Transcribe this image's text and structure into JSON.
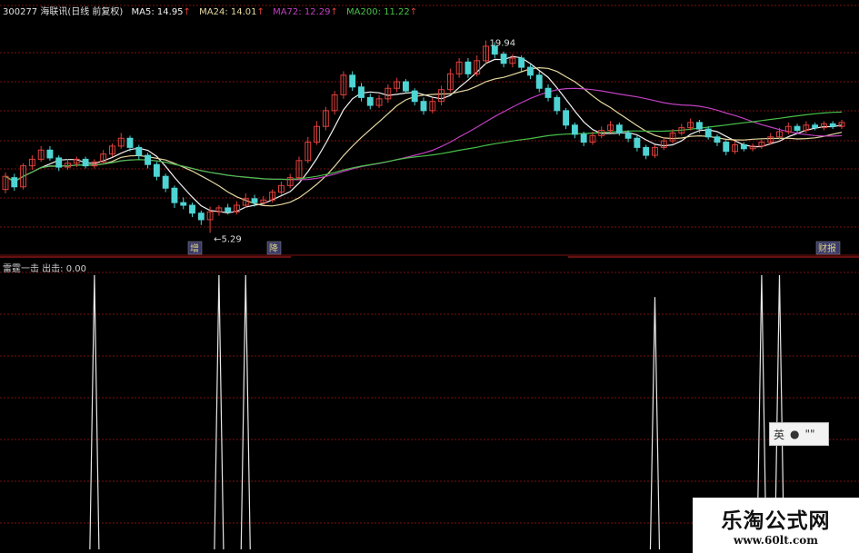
{
  "header": {
    "code_title": "300277 海联讯(日线 前复权)",
    "ma5": "MA5: 14.95",
    "ma24": "MA24: 14.01",
    "ma72": "MA72: 12.29",
    "ma200": "MA200: 11.22",
    "arrows": [
      "↑",
      "↑",
      "↑",
      "↑"
    ]
  },
  "colors": {
    "up": "#e0413c",
    "down": "#4fd4d4",
    "ma5": "#f2f2f2",
    "ma24": "#e6d8a0",
    "ma72": "#c040c0",
    "ma200": "#48c048",
    "grid": "#7a1010",
    "signal": "#e8e8e8",
    "header_code": "#e0e0e0",
    "header_ma24": "#e6d8a0",
    "header_ma72": "#c040c0",
    "header_ma200": "#48c048"
  },
  "annotations": {
    "high_label": "19.94",
    "low_label": "←5.29",
    "markers": [
      "增",
      "降",
      "财报"
    ]
  },
  "indicator": {
    "title": "雷霆一击 出击: 0.00"
  },
  "ime_toolbar": {
    "lang": "英",
    "icon2": "●",
    "icon3": "\"\""
  },
  "watermark": {
    "line1": "乐淘公式网",
    "line2": "www.60lt.com"
  },
  "chart_data": [
    {
      "type": "candlestick",
      "title": "300277 海联讯(日线 前复权)",
      "ylim": [
        4.5,
        21.5
      ],
      "candles": [
        [
          8.6,
          9.6,
          9.9,
          8.3
        ],
        [
          9.5,
          8.8,
          9.8,
          8.5
        ],
        [
          8.8,
          10.4,
          10.6,
          8.6
        ],
        [
          10.4,
          10.9,
          11.2,
          10.1
        ],
        [
          10.9,
          11.6,
          11.9,
          10.7
        ],
        [
          11.6,
          11.0,
          11.9,
          10.8
        ],
        [
          11.0,
          10.3,
          11.2,
          10.0
        ],
        [
          10.3,
          10.6,
          10.9,
          10.1
        ],
        [
          10.6,
          10.9,
          11.1,
          10.3
        ],
        [
          10.9,
          10.4,
          11.1,
          10.2
        ],
        [
          10.4,
          10.7,
          10.9,
          10.2
        ],
        [
          10.7,
          11.3,
          11.6,
          10.5
        ],
        [
          11.3,
          11.9,
          12.1,
          11.1
        ],
        [
          11.9,
          12.5,
          12.9,
          11.7
        ],
        [
          12.5,
          11.8,
          12.7,
          11.5
        ],
        [
          11.8,
          11.2,
          12.0,
          10.9
        ],
        [
          11.2,
          10.5,
          11.4,
          10.2
        ],
        [
          10.5,
          9.6,
          10.7,
          9.3
        ],
        [
          9.6,
          8.7,
          9.8,
          8.4
        ],
        [
          8.7,
          7.6,
          8.9,
          7.2
        ],
        [
          7.6,
          7.4,
          8.0,
          7.1
        ],
        [
          7.4,
          6.8,
          7.6,
          6.5
        ],
        [
          6.8,
          6.3,
          7.0,
          5.9
        ],
        [
          6.3,
          6.9,
          7.3,
          5.3
        ],
        [
          6.9,
          7.2,
          7.4,
          6.6
        ],
        [
          7.2,
          6.9,
          7.5,
          6.7
        ],
        [
          6.9,
          7.4,
          7.7,
          6.7
        ],
        [
          7.4,
          7.9,
          8.3,
          7.2
        ],
        [
          7.9,
          7.6,
          8.2,
          7.3
        ],
        [
          7.6,
          7.8,
          8.1,
          7.4
        ],
        [
          7.8,
          8.4,
          8.6,
          7.6
        ],
        [
          8.4,
          8.9,
          9.2,
          8.2
        ],
        [
          8.9,
          9.5,
          9.8,
          8.7
        ],
        [
          9.5,
          10.8,
          11.1,
          9.3
        ],
        [
          10.8,
          12.2,
          12.6,
          10.6
        ],
        [
          12.2,
          13.4,
          13.8,
          12.0
        ],
        [
          13.4,
          14.6,
          14.9,
          13.1
        ],
        [
          14.6,
          15.8,
          16.1,
          14.3
        ],
        [
          15.8,
          17.3,
          17.6,
          15.5
        ],
        [
          17.3,
          16.4,
          17.6,
          16.1
        ],
        [
          16.4,
          15.6,
          16.7,
          15.3
        ],
        [
          15.6,
          15.0,
          15.9,
          14.7
        ],
        [
          15.0,
          15.5,
          15.8,
          14.8
        ],
        [
          15.5,
          16.3,
          16.6,
          15.2
        ],
        [
          16.3,
          16.8,
          17.1,
          16.0
        ],
        [
          16.8,
          16.1,
          17.0,
          15.9
        ],
        [
          16.1,
          15.3,
          16.3,
          15.0
        ],
        [
          15.3,
          14.6,
          15.6,
          14.3
        ],
        [
          14.6,
          15.3,
          15.6,
          14.4
        ],
        [
          15.3,
          16.2,
          16.5,
          15.0
        ],
        [
          16.2,
          17.4,
          17.8,
          16.0
        ],
        [
          17.4,
          18.3,
          18.6,
          17.1
        ],
        [
          18.3,
          17.4,
          18.6,
          17.1
        ],
        [
          17.4,
          18.4,
          18.8,
          17.2
        ],
        [
          18.4,
          19.5,
          19.94,
          18.1
        ],
        [
          19.5,
          18.9,
          19.8,
          18.6
        ],
        [
          18.9,
          18.2,
          19.1,
          17.9
        ],
        [
          18.2,
          18.6,
          18.9,
          17.9
        ],
        [
          18.6,
          17.9,
          18.8,
          17.6
        ],
        [
          17.9,
          17.3,
          18.1,
          17.0
        ],
        [
          17.3,
          16.3,
          17.6,
          16.0
        ],
        [
          16.3,
          15.6,
          16.6,
          15.3
        ],
        [
          15.6,
          14.6,
          15.8,
          14.3
        ],
        [
          14.6,
          13.5,
          14.8,
          13.2
        ],
        [
          13.5,
          12.8,
          13.7,
          12.5
        ],
        [
          12.8,
          12.2,
          13.0,
          11.9
        ],
        [
          12.2,
          12.7,
          13.0,
          12.0
        ],
        [
          12.7,
          13.1,
          13.4,
          12.5
        ],
        [
          13.1,
          13.5,
          13.8,
          12.9
        ],
        [
          13.5,
          12.9,
          13.7,
          12.7
        ],
        [
          12.9,
          12.5,
          13.1,
          12.2
        ],
        [
          12.5,
          11.8,
          12.7,
          11.5
        ],
        [
          11.8,
          11.2,
          12.0,
          10.9
        ],
        [
          11.2,
          11.8,
          12.0,
          11.0
        ],
        [
          11.8,
          12.3,
          12.6,
          11.6
        ],
        [
          12.3,
          12.9,
          13.2,
          12.1
        ],
        [
          12.9,
          13.3,
          13.6,
          12.7
        ],
        [
          13.3,
          13.7,
          14.0,
          13.1
        ],
        [
          13.7,
          13.2,
          13.9,
          12.9
        ],
        [
          13.2,
          12.6,
          13.4,
          12.4
        ],
        [
          12.6,
          12.2,
          12.8,
          11.9
        ],
        [
          12.2,
          11.5,
          12.4,
          11.2
        ],
        [
          11.5,
          12.0,
          12.3,
          11.3
        ],
        [
          12.0,
          11.7,
          12.2,
          11.5
        ],
        [
          11.7,
          11.9,
          12.1,
          11.5
        ],
        [
          11.9,
          12.2,
          12.4,
          11.7
        ],
        [
          12.2,
          12.6,
          12.9,
          12.0
        ],
        [
          12.6,
          13.0,
          13.3,
          12.4
        ],
        [
          13.0,
          13.4,
          13.7,
          12.8
        ],
        [
          13.4,
          13.1,
          13.6,
          12.9
        ],
        [
          13.1,
          13.5,
          13.8,
          12.9
        ],
        [
          13.5,
          13.3,
          13.7,
          13.1
        ],
        [
          13.3,
          13.6,
          13.8,
          13.1
        ],
        [
          13.6,
          13.4,
          13.8,
          13.2
        ],
        [
          13.4,
          13.7,
          13.9,
          13.2
        ]
      ],
      "annotations": [
        {
          "text": "19.94",
          "x": 54,
          "y": 19.94
        },
        {
          "text": "←5.29",
          "x": 23,
          "y": 5.29
        }
      ]
    },
    {
      "type": "line",
      "title": "雷霆一击 出击: 0.00",
      "series": [
        {
          "name": "出击",
          "spikes": [
            {
              "index": 10,
              "height": 1.0
            },
            {
              "index": 24,
              "height": 1.0
            },
            {
              "index": 27,
              "height": 1.0
            },
            {
              "index": 73,
              "height": 0.92
            },
            {
              "index": 85,
              "height": 1.0
            },
            {
              "index": 87,
              "height": 1.0
            }
          ]
        }
      ]
    }
  ]
}
